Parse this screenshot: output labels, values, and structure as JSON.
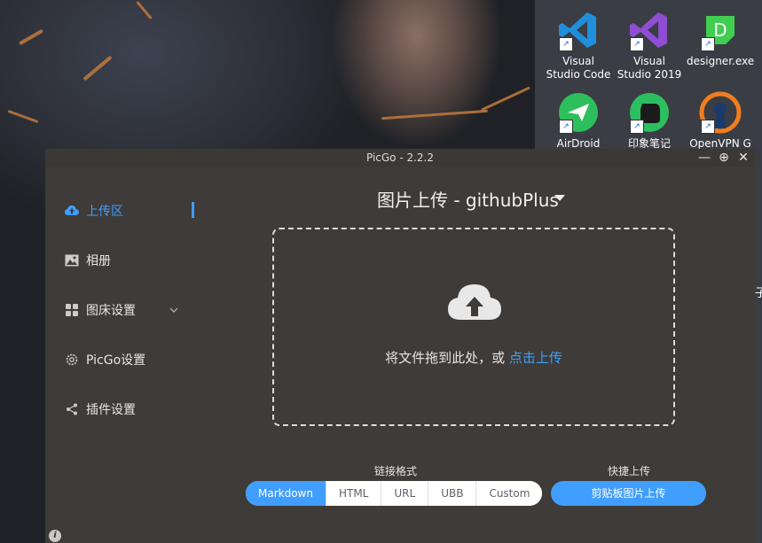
{
  "desktop": {
    "icons": [
      {
        "label": "Visual Studio Code",
        "icon": "vscode-icon"
      },
      {
        "label": "Visual Studio 2019",
        "icon": "visual-studio-icon"
      },
      {
        "label": "designer.exe",
        "icon": "qt-designer-icon"
      },
      {
        "label": "AirDroid",
        "icon": "airdroid-icon"
      },
      {
        "label": "印象笔记",
        "icon": "evernote-icon"
      },
      {
        "label": "OpenVPN G",
        "icon": "openvpn-icon"
      }
    ],
    "edge_text": "子"
  },
  "window": {
    "title": "PicGo - 2.2.2",
    "controls": [
      "—",
      "⊕",
      "✕"
    ]
  },
  "sidebar": {
    "items": [
      {
        "label": "上传区",
        "icon": "upload-cloud-icon",
        "active": true
      },
      {
        "label": "相册",
        "icon": "picture-icon"
      },
      {
        "label": "图床设置",
        "icon": "grid-icon"
      },
      {
        "label": "PicGo设置",
        "icon": "gear-icon"
      },
      {
        "label": "插件设置",
        "icon": "share-icon"
      }
    ]
  },
  "main": {
    "title": "图片上传 - githubPlus",
    "drop_text": "将文件拖到此处，或 ",
    "drop_link": "点击上传",
    "format_label": "链接格式",
    "formats": [
      "Markdown",
      "HTML",
      "URL",
      "UBB",
      "Custom"
    ],
    "active_format": "Markdown",
    "quick_label": "快捷上传",
    "quick_button": "剪贴板图片上传"
  },
  "colors": {
    "accent": "#409eff",
    "window_bg": "#3e3b38"
  }
}
